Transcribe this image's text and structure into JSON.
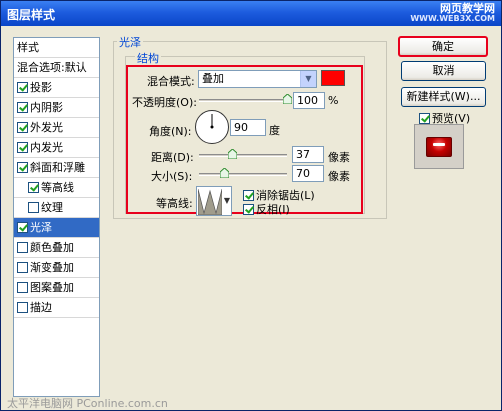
{
  "window": {
    "title": "图层样式",
    "watermark": "网页教学网",
    "watermark_url": "WWW.WEB3X.COM"
  },
  "style_list": {
    "header": "样式",
    "blend_options": "混合选项:默认",
    "items": [
      {
        "label": "投影",
        "checked": true,
        "selected": false,
        "indent": false
      },
      {
        "label": "内阴影",
        "checked": true,
        "selected": false,
        "indent": false
      },
      {
        "label": "外发光",
        "checked": true,
        "selected": false,
        "indent": false
      },
      {
        "label": "内发光",
        "checked": true,
        "selected": false,
        "indent": false
      },
      {
        "label": "斜面和浮雕",
        "checked": true,
        "selected": false,
        "indent": false
      },
      {
        "label": "等高线",
        "checked": true,
        "selected": false,
        "indent": true
      },
      {
        "label": "纹理",
        "checked": false,
        "selected": false,
        "indent": true
      },
      {
        "label": "光泽",
        "checked": true,
        "selected": true,
        "indent": false
      },
      {
        "label": "颜色叠加",
        "checked": false,
        "selected": false,
        "indent": false
      },
      {
        "label": "渐变叠加",
        "checked": false,
        "selected": false,
        "indent": false
      },
      {
        "label": "图案叠加",
        "checked": false,
        "selected": false,
        "indent": false
      },
      {
        "label": "描边",
        "checked": false,
        "selected": false,
        "indent": false
      }
    ]
  },
  "satin": {
    "group_title": "光泽",
    "structure_title": "结构",
    "blend_mode_label": "混合模式:",
    "blend_mode_value": "叠加",
    "blend_color": "#ff0000",
    "opacity_label": "不透明度(O):",
    "opacity_value": "100",
    "opacity_unit": "%",
    "opacity_level": 1.0,
    "angle_label": "角度(N):",
    "angle_value": "90",
    "angle_unit": "度",
    "distance_label": "距离(D):",
    "distance_value": "37",
    "distance_unit": "像素",
    "distance_level": 0.37,
    "size_label": "大小(S):",
    "size_value": "70",
    "size_unit": "像素",
    "size_level": 0.28,
    "contour_label": "等高线:",
    "anti_alias_label": "消除锯齿(L)",
    "anti_alias_checked": true,
    "invert_label": "反相(I)",
    "invert_checked": true
  },
  "buttons": {
    "ok": "确定",
    "cancel": "取消",
    "new_style": "新建样式(W)...",
    "preview_label": "预览(V)",
    "preview_checked": true
  },
  "footer": "太平洋电脑网 PConline.com.cn",
  "colors": {
    "accent": "#e8001c",
    "selection": "#316ac5",
    "title_bar": "#0a45c8"
  }
}
